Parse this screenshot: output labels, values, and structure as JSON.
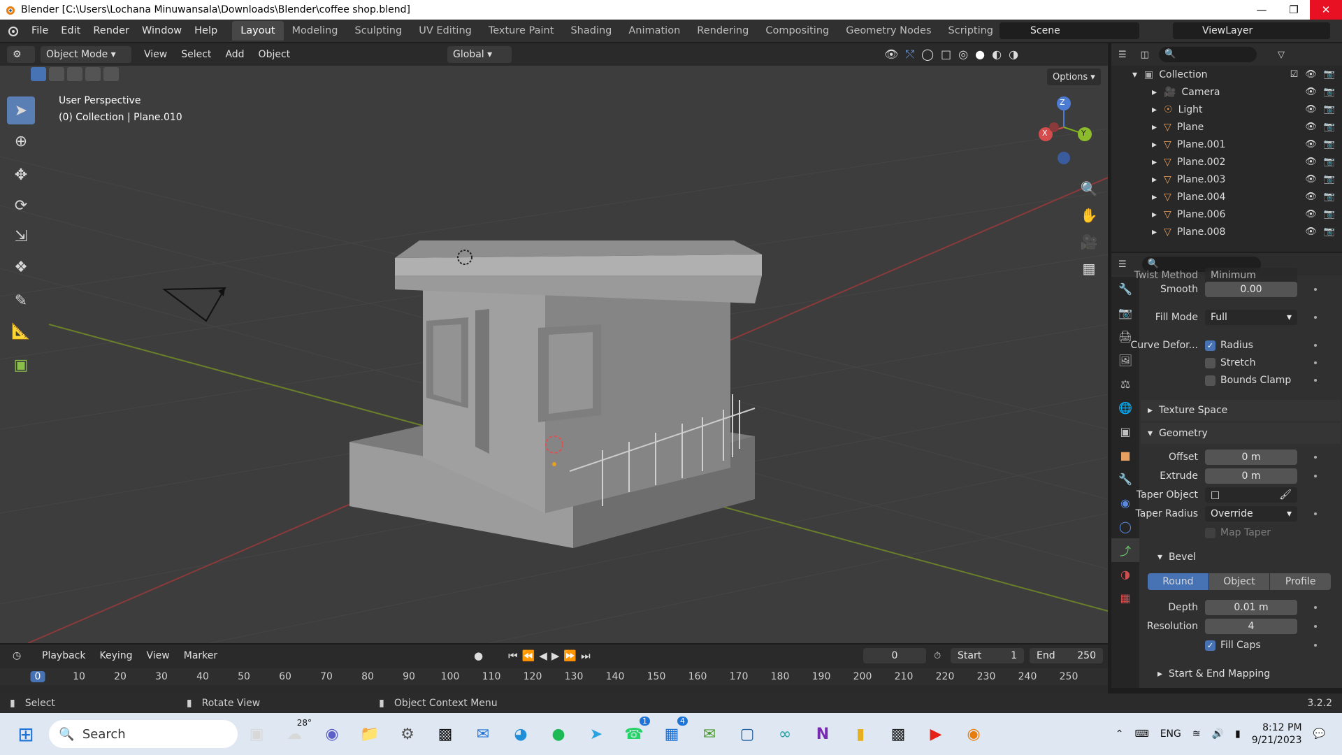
{
  "window": {
    "title": "Blender [C:\\Users\\Lochana Minuwansala\\Downloads\\Blender\\coffee shop.blend]"
  },
  "menu": [
    "File",
    "Edit",
    "Render",
    "Window",
    "Help"
  ],
  "workspaces": [
    "Layout",
    "Modeling",
    "Sculpting",
    "UV Editing",
    "Texture Paint",
    "Shading",
    "Animation",
    "Rendering",
    "Compositing",
    "Geometry Nodes",
    "Scripting"
  ],
  "scene": "Scene",
  "view_layer": "ViewLayer",
  "viewport_header": {
    "mode": "Object Mode",
    "menus": [
      "View",
      "Select",
      "Add",
      "Object"
    ],
    "orientation": "Global",
    "options": "Options"
  },
  "viewport": {
    "perspective": "User Perspective",
    "collection_info": "(0) Collection | Plane.010"
  },
  "outliner": {
    "collection": "Collection",
    "items": [
      "Camera",
      "Light",
      "Plane",
      "Plane.001",
      "Plane.002",
      "Plane.003",
      "Plane.004",
      "Plane.006",
      "Plane.008"
    ]
  },
  "properties": {
    "twist_method": {
      "label": "Twist Method",
      "value": "Minimum"
    },
    "smooth": {
      "label": "Smooth",
      "value": "0.00"
    },
    "fill_mode": {
      "label": "Fill Mode",
      "value": "Full"
    },
    "curve_deform": {
      "label": "Curve Defor...",
      "radius": "Radius",
      "stretch": "Stretch",
      "bounds_clamp": "Bounds Clamp"
    },
    "texture_space": "Texture Space",
    "geometry": "Geometry",
    "offset": {
      "label": "Offset",
      "value": "0 m"
    },
    "extrude": {
      "label": "Extrude",
      "value": "0 m"
    },
    "taper_object": {
      "label": "Taper Object"
    },
    "taper_radius": {
      "label": "Taper Radius",
      "value": "Override"
    },
    "map_taper": "Map Taper",
    "bevel": "Bevel",
    "bevel_tabs": [
      "Round",
      "Object",
      "Profile"
    ],
    "depth": {
      "label": "Depth",
      "value": "0.01 m"
    },
    "resolution": {
      "label": "Resolution",
      "value": "4"
    },
    "fill_caps": "Fill Caps",
    "start_end": "Start & End Mapping"
  },
  "timeline": {
    "menus": [
      "Playback",
      "Keying",
      "View",
      "Marker"
    ],
    "current_frame": "0",
    "start_label": "Start",
    "start": "1",
    "end_label": "End",
    "end": "250",
    "ticks": [
      "0",
      "10",
      "20",
      "30",
      "40",
      "50",
      "60",
      "70",
      "80",
      "90",
      "100",
      "110",
      "120",
      "130",
      "140",
      "150",
      "160",
      "170",
      "180",
      "190",
      "200",
      "210",
      "220",
      "230",
      "240",
      "250"
    ]
  },
  "statusbar": {
    "select": "Select",
    "rotate": "Rotate View",
    "context": "Object Context Menu",
    "version": "3.2.2"
  },
  "taskbar": {
    "search": "Search",
    "weather": "28°",
    "lang": "ENG",
    "time": "8:12 PM",
    "date": "9/21/2023",
    "badges": [
      "1",
      "4"
    ]
  }
}
